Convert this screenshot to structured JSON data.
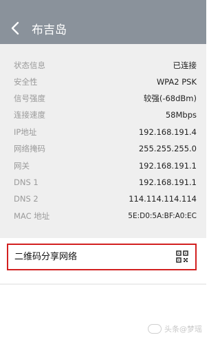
{
  "header": {
    "title": "布吉岛",
    "background_color": "#8a929b"
  },
  "info": {
    "rows": [
      {
        "label": "状态信息",
        "value": "已连接"
      },
      {
        "label": "安全性",
        "value": "WPA2 PSK"
      },
      {
        "label": "信号强度",
        "value": "较强(-68dBm)"
      },
      {
        "label": "连接速度",
        "value": "58Mbps"
      },
      {
        "label": "IP地址",
        "value": "192.168.191.4"
      },
      {
        "label": "网络掩码",
        "value": "255.255.255.0"
      },
      {
        "label": "网关",
        "value": "192.168.191.1"
      },
      {
        "label": "DNS 1",
        "value": "192.168.191.1"
      },
      {
        "label": "DNS 2",
        "value": "114.114.114.114"
      },
      {
        "label": "MAC 地址",
        "value": "5E:D0:5A:BF:A0:EC"
      }
    ]
  },
  "share": {
    "label": "二维码分享网络",
    "highlight_color": "#d21f1f"
  },
  "watermark": {
    "text": "头条@梦瑶",
    "note": "watermark lettering reproduced faintly"
  }
}
